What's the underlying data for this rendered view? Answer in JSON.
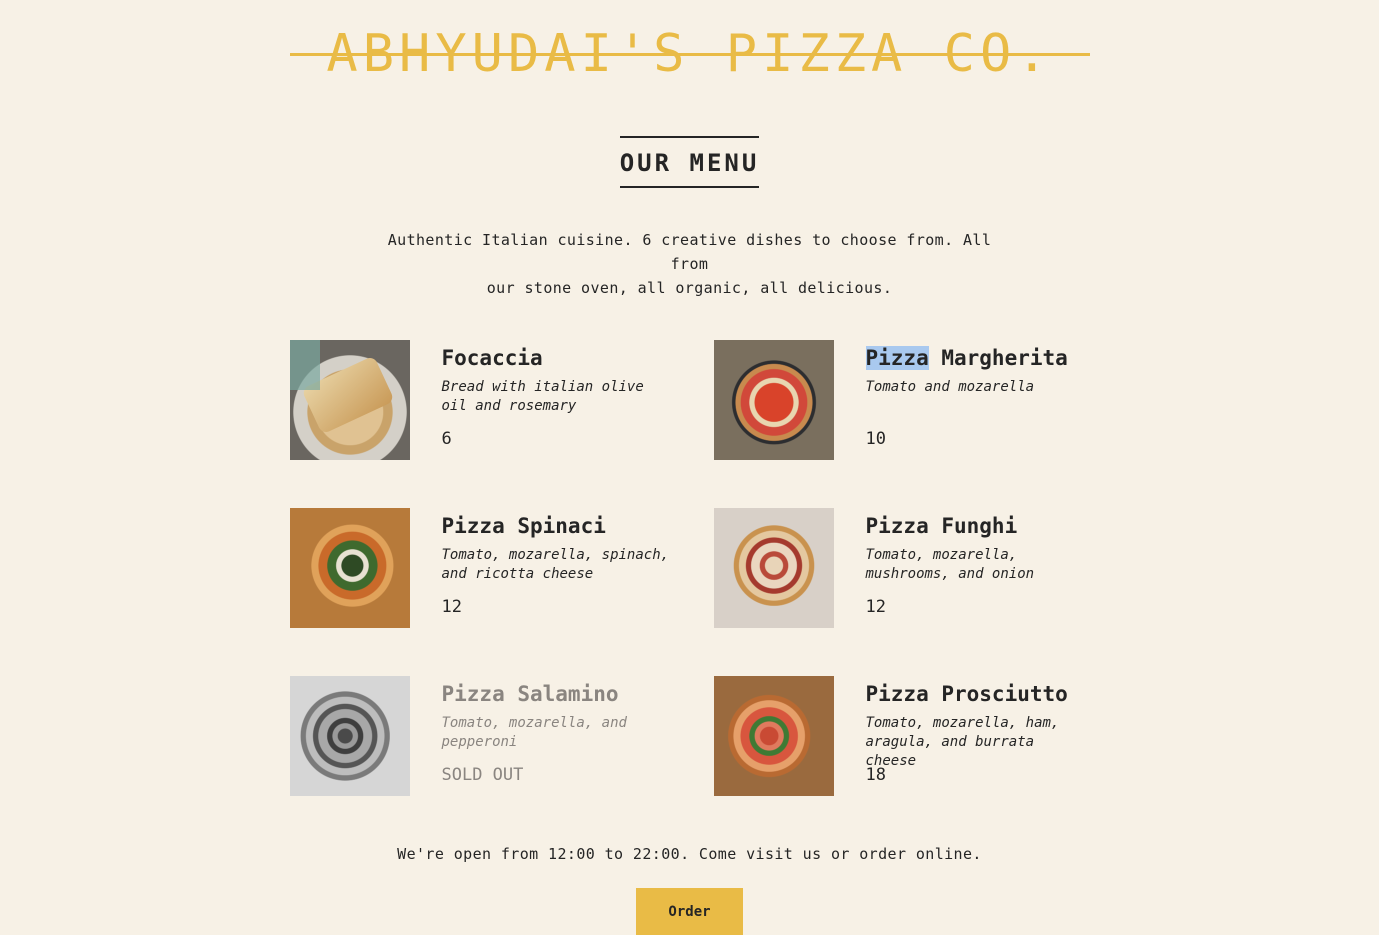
{
  "header": {
    "title": "ABHYUDAI'S PIZZA CO."
  },
  "menu": {
    "heading": "OUR MENU",
    "intro_line1": "Authentic Italian cuisine. 6 creative dishes to choose from. All from",
    "intro_line2": "our stone oven, all organic, all delicious."
  },
  "dishes": [
    {
      "name": "Focaccia",
      "desc_line1": "Bread with italian olive",
      "desc_line2": "oil and rosemary",
      "price": "6",
      "photo": "focaccia-photo"
    },
    {
      "name_highlight": "Pizza",
      "name_rest": " Margherita",
      "desc_line1": "Tomato and mozarella",
      "desc_line2": "",
      "price": "10",
      "photo": "margherita-photo"
    },
    {
      "name": "Pizza Spinaci",
      "desc_line1": "Tomato, mozarella, spinach,",
      "desc_line2": "and ricotta cheese",
      "price": "12",
      "photo": "spinaci-photo"
    },
    {
      "name": "Pizza Funghi",
      "desc_line1": "Tomato, mozarella,",
      "desc_line2": "mushrooms, and onion",
      "price": "12",
      "photo": "funghi-photo"
    },
    {
      "name": "Pizza Salamino",
      "desc_line1": "Tomato, mozarella, and",
      "desc_line2": "pepperoni",
      "price": "SOLD OUT",
      "sold_out": true,
      "photo": "salamino-photo"
    },
    {
      "name": "Pizza Prosciutto",
      "desc_line1": "Tomato, mozarella, ham,",
      "desc_line2": "aragula, and burrata cheese",
      "price": "18",
      "photo": "prosciutto-photo"
    }
  ],
  "footer": {
    "hours_text": "We're open from 12:00 to 22:00. Come visit us or order online.",
    "order_label": "Order"
  },
  "colors": {
    "background": "#f7f1e6",
    "accent": "#e9bb46",
    "text": "#252525",
    "sold_out_text": "#8a8580",
    "selection": "#a9c9ef"
  }
}
